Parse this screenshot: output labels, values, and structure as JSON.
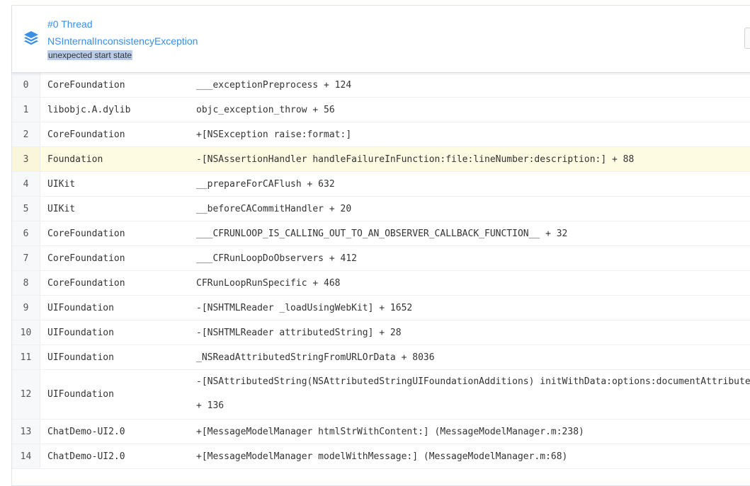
{
  "header": {
    "thread_title": "#0 Thread",
    "exception_name": "NSInternalInconsistencyException",
    "reason": "unexpected start state",
    "icon": "layers-icon",
    "accent_color": "#3a8ee6",
    "highlight_color": "#fdfbe2"
  },
  "frames": [
    {
      "index": "0",
      "library": "CoreFoundation",
      "symbol": "___exceptionPreprocess + 124"
    },
    {
      "index": "1",
      "library": "libobjc.A.dylib",
      "symbol": "objc_exception_throw + 56"
    },
    {
      "index": "2",
      "library": "CoreFoundation",
      "symbol": "+[NSException raise:format:]"
    },
    {
      "index": "3",
      "library": "Foundation",
      "symbol": "-[NSAssertionHandler handleFailureInFunction:file:lineNumber:description:] + 88",
      "highlighted": true
    },
    {
      "index": "4",
      "library": "UIKit",
      "symbol": "__prepareForCAFlush + 632"
    },
    {
      "index": "5",
      "library": "UIKit",
      "symbol": "__beforeCACommitHandler + 20"
    },
    {
      "index": "6",
      "library": "CoreFoundation",
      "symbol": "___CFRUNLOOP_IS_CALLING_OUT_TO_AN_OBSERVER_CALLBACK_FUNCTION__ + 32"
    },
    {
      "index": "7",
      "library": "CoreFoundation",
      "symbol": "___CFRunLoopDoObservers + 412"
    },
    {
      "index": "8",
      "library": "CoreFoundation",
      "symbol": "CFRunLoopRunSpecific + 468"
    },
    {
      "index": "9",
      "library": "UIFoundation",
      "symbol": "-[NSHTMLReader _loadUsingWebKit] + 1652"
    },
    {
      "index": "10",
      "library": "UIFoundation",
      "symbol": "-[NSHTMLReader attributedString] + 28"
    },
    {
      "index": "11",
      "library": "UIFoundation",
      "symbol": "_NSReadAttributedStringFromURLOrData + 8036"
    },
    {
      "index": "12",
      "library": "UIFoundation",
      "symbol_line1": "-[NSAttributedString(NSAttributedStringUIFoundationAdditions) initWithData:options:documentAttributes:",
      "symbol_line2": "+ 136"
    },
    {
      "index": "13",
      "library": "ChatDemo-UI2.0",
      "symbol": "+[MessageModelManager htmlStrWithContent:] (MessageModelManager.m:238)"
    },
    {
      "index": "14",
      "library": "ChatDemo-UI2.0",
      "symbol": "+[MessageModelManager modelWithMessage:] (MessageModelManager.m:68)"
    }
  ]
}
